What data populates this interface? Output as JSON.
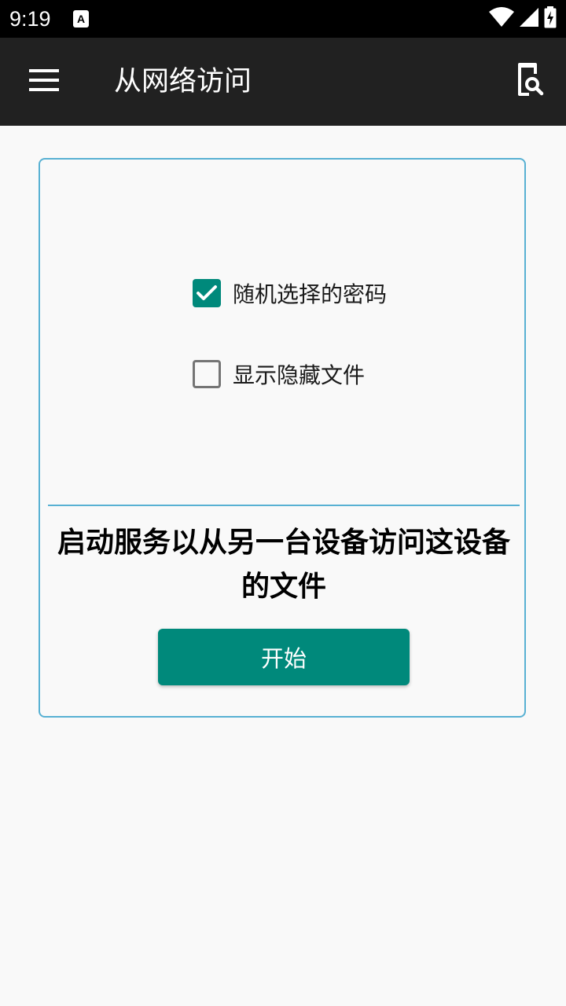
{
  "status_bar": {
    "time": "9:19",
    "icons": [
      "notification-a-icon",
      "wifi-icon",
      "signal-icon",
      "battery-charging-icon"
    ]
  },
  "app_bar": {
    "title": "从网络访问",
    "menu_icon": "menu-icon",
    "action_icon": "device-search-icon"
  },
  "card": {
    "options": [
      {
        "label": "随机选择的密码",
        "checked": true
      },
      {
        "label": "显示隐藏文件",
        "checked": false
      }
    ],
    "message": "启动服务以从另一台设备访问这设备的文件",
    "start_label": "开始"
  },
  "colors": {
    "accent": "#00897b",
    "app_bar": "#212121",
    "card_border": "#58b1d3",
    "background": "#f9f9f9"
  }
}
